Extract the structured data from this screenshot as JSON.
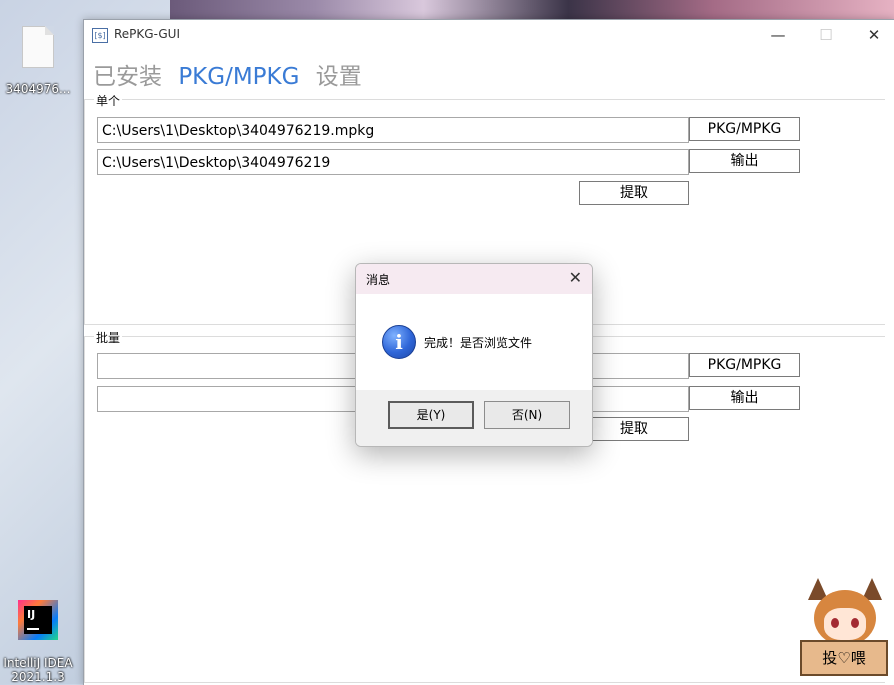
{
  "desktop": {
    "file_icon_label": "3404976...",
    "ide_icon_label": "IntelliJ IDEA",
    "ide_icon_sublabel": "2021.1.3"
  },
  "window": {
    "title": "RePKG-GUI",
    "icon_text": "[$]",
    "controls": {
      "minimize": "—",
      "maximize": "☐",
      "close": "✕"
    },
    "tabs": [
      {
        "label": "已安装",
        "active": false
      },
      {
        "label": "PKG/MPKG",
        "active": true
      },
      {
        "label": "设置",
        "active": false
      }
    ],
    "single": {
      "label": "单个",
      "input_path": "C:\\Users\\1\\Desktop\\3404976219.mpkg",
      "output_path": "C:\\Users\\1\\Desktop\\3404976219",
      "browse_label": "PKG/MPKG",
      "output_label": "输出",
      "extract_label": "提取"
    },
    "batch": {
      "label": "批量",
      "input_path": "",
      "output_path": "",
      "browse_label": "PKG/MPKG",
      "output_label": "输出",
      "extract_label": "提取"
    }
  },
  "dialog": {
    "title": "消息",
    "close": "✕",
    "icon": "info-icon",
    "message": "完成！是否浏览文件",
    "yes_label": "是(Y)",
    "no_label": "否(N)"
  },
  "mascot": {
    "box_text": "投♡喂"
  }
}
